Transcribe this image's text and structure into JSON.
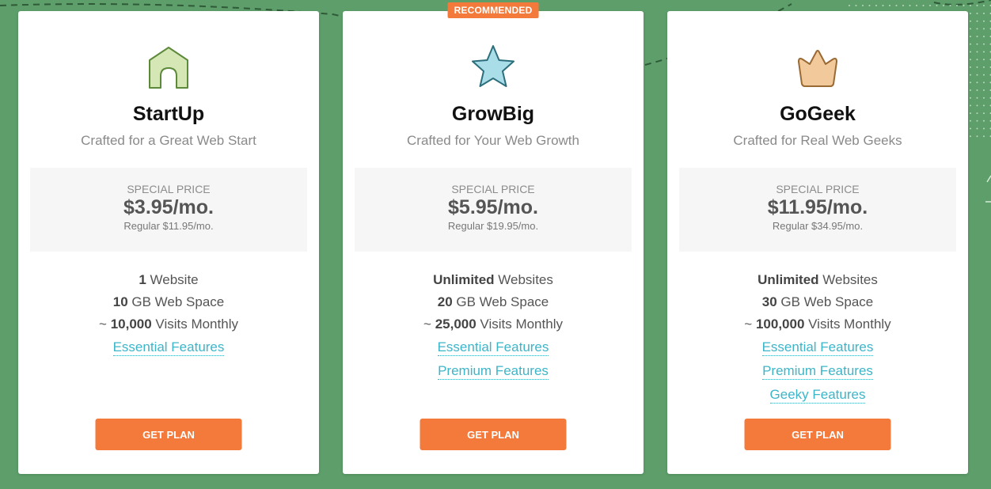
{
  "colors": {
    "background": "#5d9e6a",
    "accent": "#f47a3b",
    "link": "#3db5c9"
  },
  "plans": [
    {
      "name": "StartUp",
      "subtitle": "Crafted for a Great Web Start",
      "icon": "house-icon",
      "badge": null,
      "price_label": "SPECIAL PRICE",
      "price": "$3.95/mo.",
      "regular": "Regular $11.95/mo.",
      "features": [
        {
          "bold": "1",
          "text": " Website"
        },
        {
          "bold": "10",
          "text": " GB Web Space"
        },
        {
          "prefix": "~ ",
          "bold": "10,000",
          "text": " Visits Monthly"
        }
      ],
      "links": [
        "Essential Features"
      ],
      "button": "GET PLAN"
    },
    {
      "name": "GrowBig",
      "subtitle": "Crafted for Your Web Growth",
      "icon": "star-icon",
      "badge": "RECOMMENDED",
      "price_label": "SPECIAL PRICE",
      "price": "$5.95/mo.",
      "regular": "Regular $19.95/mo.",
      "features": [
        {
          "bold": "Unlimited",
          "text": " Websites"
        },
        {
          "bold": "20",
          "text": " GB Web Space"
        },
        {
          "prefix": "~ ",
          "bold": "25,000",
          "text": " Visits Monthly"
        }
      ],
      "links": [
        "Essential Features",
        "Premium Features"
      ],
      "button": "GET PLAN"
    },
    {
      "name": "GoGeek",
      "subtitle": "Crafted for Real Web Geeks",
      "icon": "crown-icon",
      "badge": null,
      "price_label": "SPECIAL PRICE",
      "price": "$11.95/mo.",
      "regular": "Regular $34.95/mo.",
      "features": [
        {
          "bold": "Unlimited",
          "text": " Websites"
        },
        {
          "bold": "30",
          "text": " GB Web Space"
        },
        {
          "prefix": "~ ",
          "bold": "100,000",
          "text": " Visits Monthly"
        }
      ],
      "links": [
        "Essential Features",
        "Premium Features",
        "Geeky Features"
      ],
      "button": "GET PLAN"
    }
  ]
}
